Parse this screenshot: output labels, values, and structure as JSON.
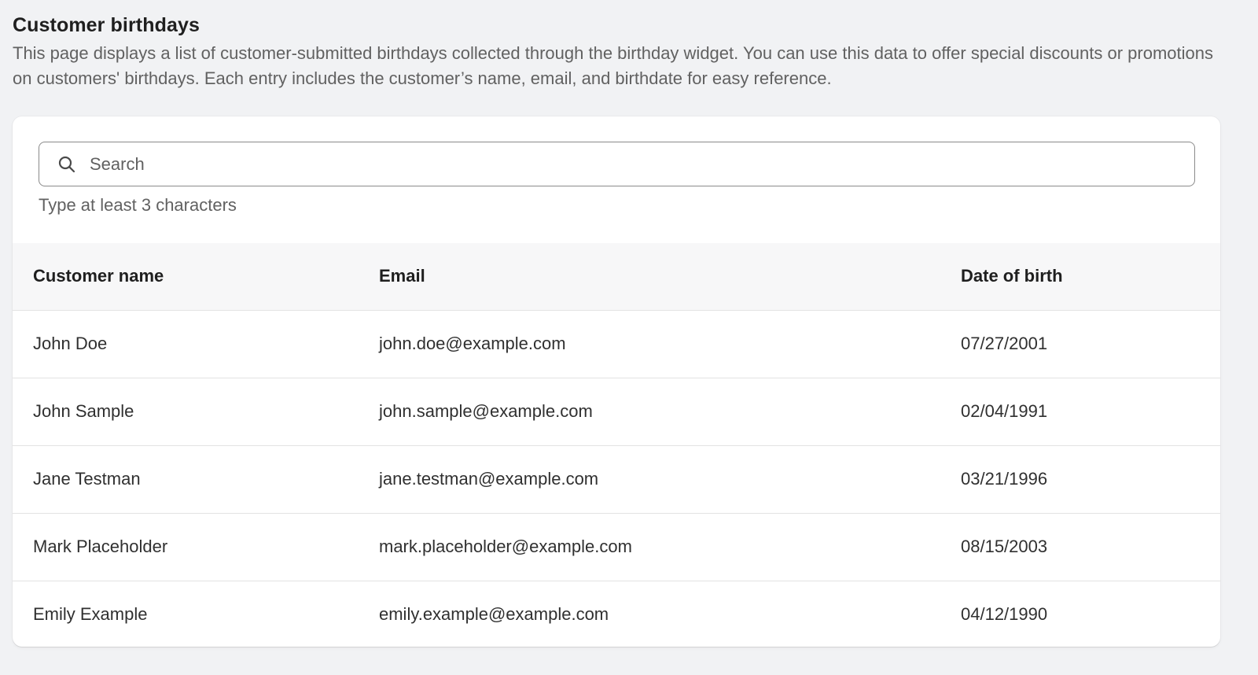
{
  "header": {
    "title": "Customer birthdays",
    "description": "This page displays a list of customer-submitted birthdays collected through the birthday widget. You can use this data to offer special discounts or promotions on customers' birthdays. Each entry includes the customer’s name, email, and birthdate for easy reference."
  },
  "search": {
    "icon": "search-icon",
    "placeholder": "Search",
    "value": "",
    "helper_text": "Type at least 3 characters"
  },
  "table": {
    "columns": [
      "Customer name",
      "Email",
      "Date of birth"
    ],
    "rows": [
      {
        "name": "John Doe",
        "email": "john.doe@example.com",
        "dob": "07/27/2001"
      },
      {
        "name": "John Sample",
        "email": "john.sample@example.com",
        "dob": "02/04/1991"
      },
      {
        "name": "Jane Testman",
        "email": "jane.testman@example.com",
        "dob": "03/21/1996"
      },
      {
        "name": "Mark Placeholder",
        "email": "mark.placeholder@example.com",
        "dob": "08/15/2003"
      },
      {
        "name": "Emily Example",
        "email": "emily.example@example.com",
        "dob": "04/12/1990"
      }
    ]
  },
  "colors": {
    "page_background": "#f1f2f4",
    "card_background": "#ffffff",
    "table_header_background": "#f7f7f8",
    "text_primary": "#303030",
    "text_secondary": "#616161"
  }
}
